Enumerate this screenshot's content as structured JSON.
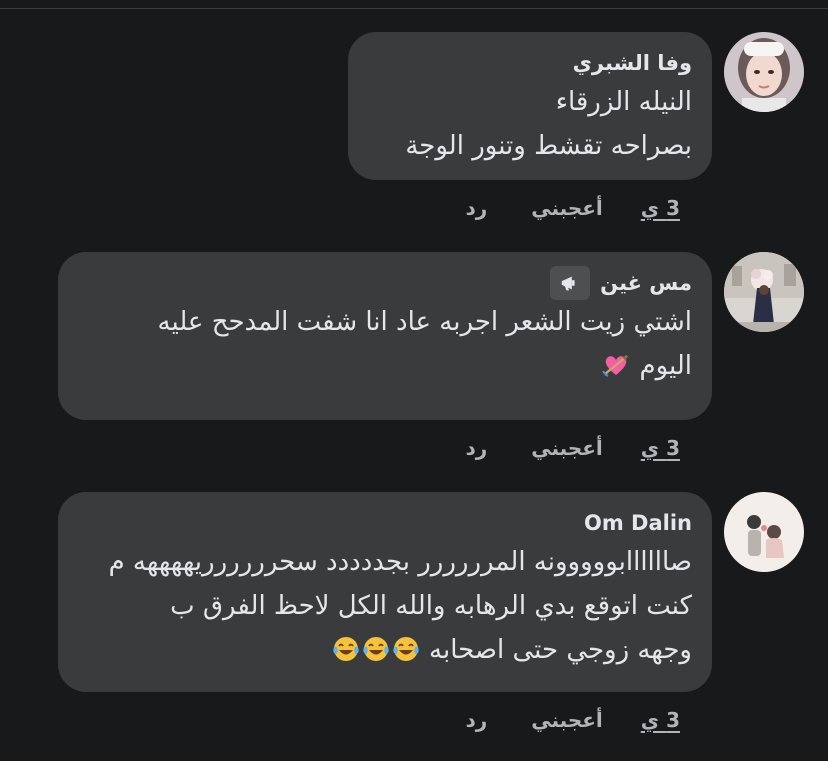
{
  "comments": [
    {
      "author": "وفا الشبري",
      "lines": [
        "النيله الزرقاء",
        "بصراحه تقشط وتنور الوجة"
      ],
      "time": "3 ي",
      "like": "أعجبني",
      "reply": "رد",
      "avatar_icon": "profile-photo"
    },
    {
      "author": "مس غين",
      "badge_icon": "megaphone-icon",
      "lines": [
        "اشتي زيت الشعر اجربه عاد انا شفت المدحح عليه",
        "اليوم"
      ],
      "emoji": [
        "heart-with-arrow-emoji"
      ],
      "time": "3 ي",
      "like": "أعجبني",
      "reply": "رد",
      "avatar_icon": "profile-photo"
    },
    {
      "author": "Om Dalin",
      "lines": [
        "صاااااابووووونه المرررررر بجددددد سحرررررريههههه م",
        "كنت اتوقع بدي الرهابه والله الكل لاحظ الفرق ب",
        "وجهه زوجي حتى اصحابه"
      ],
      "emoji": [
        "tears-of-joy-emoji",
        "tears-of-joy-emoji",
        "tears-of-joy-emoji"
      ],
      "time": "3 ي",
      "like": "أعجبني",
      "reply": "رد",
      "avatar_icon": "profile-photo"
    }
  ],
  "colors": {
    "background": "#18191a",
    "bubble": "#3a3b3c",
    "text": "#e4e6eb",
    "meta": "#b0b3b8"
  }
}
